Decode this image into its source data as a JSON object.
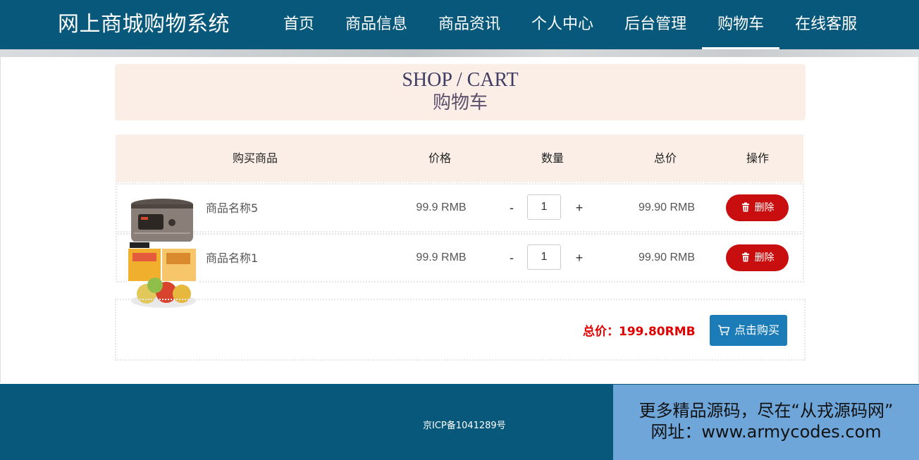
{
  "header": {
    "brand": "网上商城购物系统",
    "nav": [
      {
        "label": "首页"
      },
      {
        "label": "商品信息"
      },
      {
        "label": "商品资讯"
      },
      {
        "label": "个人中心"
      },
      {
        "label": "后台管理"
      },
      {
        "label": "购物车",
        "active": true
      },
      {
        "label": "在线客服"
      }
    ]
  },
  "page_title": {
    "en": "SHOP / CART",
    "cn": "购物车"
  },
  "table": {
    "headers": [
      "购买商品",
      "价格",
      "数量",
      "总价",
      "操作"
    ],
    "rows": [
      {
        "name": "商品名称5",
        "price": "99.9 RMB",
        "minus": "-",
        "qty": "1",
        "plus": "+",
        "total": "99.90 RMB",
        "delete": "删除",
        "image": "rice-cooker"
      },
      {
        "name": "商品名称1",
        "price": "99.9 RMB",
        "minus": "-",
        "qty": "1",
        "plus": "+",
        "total": "99.90 RMB",
        "delete": "删除",
        "image": "mooncake-box"
      }
    ]
  },
  "summary": {
    "total_label": "总价：199.80RMB",
    "buy_label": "点击购买"
  },
  "footer": {
    "icp": "京ICP备1041289号"
  },
  "watermark": {
    "line1": "更多精品源码，尽在“从戎源码网”",
    "line2": "网址：www.armycodes.com"
  },
  "colors": {
    "nav_bg": "#07587a",
    "accent_red": "#c80e0e",
    "buy_blue": "#1b7cb8",
    "title_bg": "#fbeee7"
  }
}
